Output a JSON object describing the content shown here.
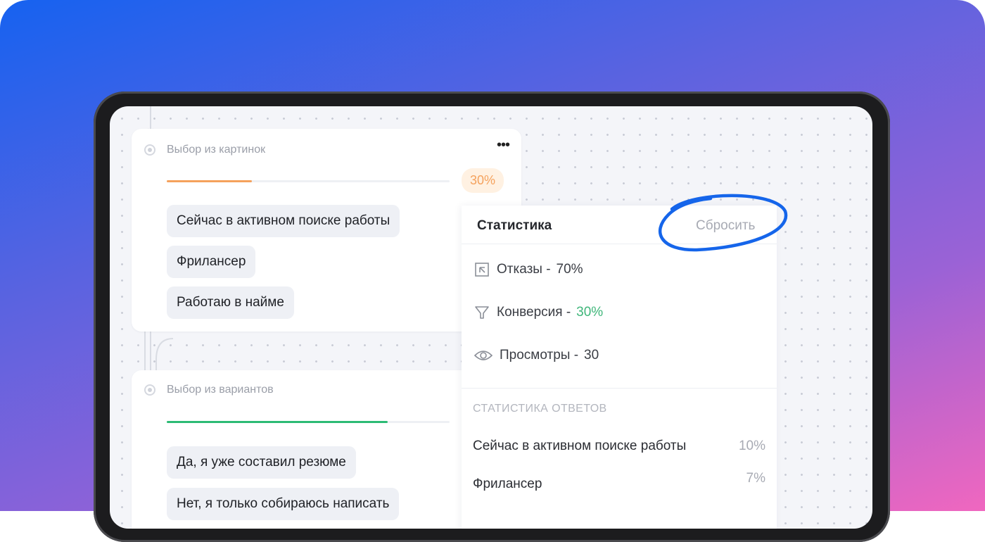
{
  "cards": [
    {
      "title": "Выбор из картинок",
      "progress_percent": 30,
      "percent_label": "30%",
      "progress_color": "#f5a25d",
      "options": [
        "Сейчас в активном поиске работы",
        "Фрилансер",
        "Работаю в найме"
      ]
    },
    {
      "title": "Выбор из вариантов",
      "progress_percent": 78,
      "progress_color": "#2dbb75",
      "options": [
        "Да, я уже составил резюме",
        "Нет, я только собираюсь написать"
      ]
    }
  ],
  "stats_panel": {
    "title": "Статистика",
    "reset_label": "Сбросить",
    "stats": [
      {
        "icon": "cursor-box-icon",
        "label": "Отказы -",
        "value": "70%",
        "value_color": "#3a3d44"
      },
      {
        "icon": "funnel-icon",
        "label": "Конверсия -",
        "value": "30%",
        "value_color": "#3fb67a"
      },
      {
        "icon": "eye-icon",
        "label": "Просмотры -",
        "value": "30",
        "value_color": "#3a3d44"
      }
    ],
    "answers_title": "СТАТИСТИКА ОТВЕТОВ",
    "answers": [
      {
        "label": "Сейчас в активном поиске работы",
        "percent": "10%"
      },
      {
        "label": "Фрилансер",
        "percent": "7%"
      }
    ]
  },
  "colors": {
    "accent_circle": "#1565ea"
  }
}
